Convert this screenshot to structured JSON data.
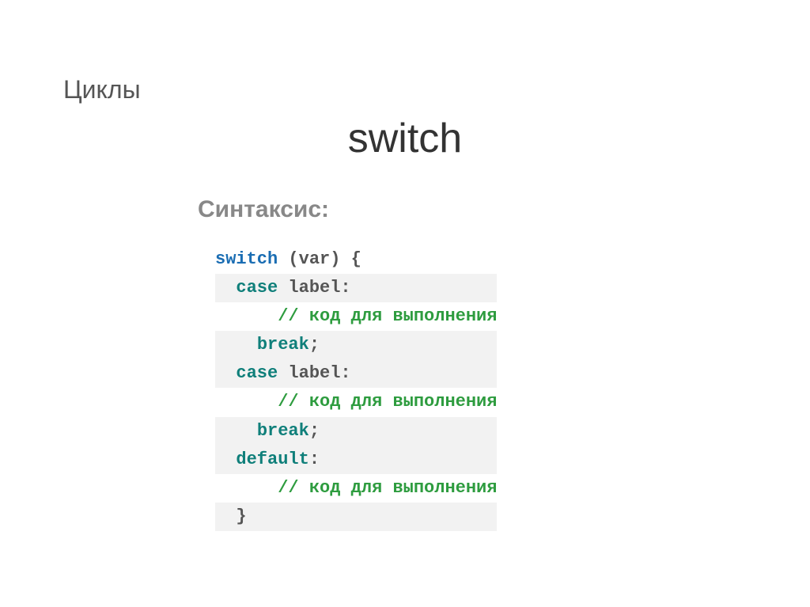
{
  "breadcrumb": "Циклы",
  "title": "switch",
  "syntax_label": "Синтаксис:",
  "code": {
    "kw_switch": "switch",
    "paren_var": " (var) {",
    "kw_case": "case",
    "label_colon": " label:",
    "comment_exec": "// код для выполнения",
    "kw_break": "break",
    "semicolon": ";",
    "kw_default": "default",
    "colon": ":",
    "close_brace": "}"
  }
}
